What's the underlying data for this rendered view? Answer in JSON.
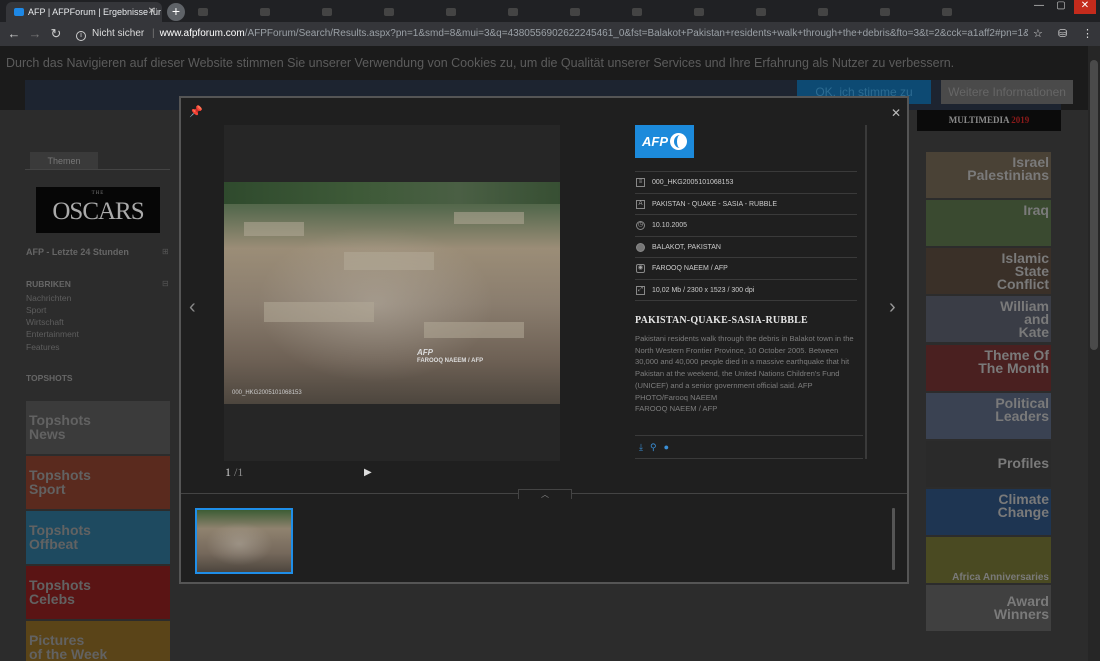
{
  "browser": {
    "active_tab_title": "AFP | AFPForum | Ergebnisse für ...",
    "url_security": "Nicht sicher",
    "url_domain": "www.afpforum.com",
    "url_path": "/AFPForum/Search/Results.aspx?pn=1&smd=8&mui=3&q=4380556902622245461_0&fst=Balakot+Pakistan+residents+walk+through+the+debris&fto=3&t=2&cck=a1aff2#pn=1&smd=8&mui..."
  },
  "cookie_banner": {
    "text": "Durch das Navigieren auf dieser Website stimmen Sie unserer Verwendung von Cookies zu, um die Qualität unserer Services und Ihre Erfahrung als Nutzer zu verbessern.",
    "accept_label": "OK, ich stimme zu",
    "more_label": "Weitere Informationen"
  },
  "page": {
    "multimedia_label": "MULTIMEDIA",
    "multimedia_suffix": "2019",
    "themen_tab": "Themen",
    "oscars_small": "THE",
    "oscars_label": "OSCARS",
    "last24_label": "AFP - Letzte 24 Stunden",
    "rubriken_heading": "RUBRIKEN",
    "rubriken": [
      "Nachrichten",
      "Sport",
      "Wirtschaft",
      "Entertainment",
      "Features"
    ],
    "topshots_heading": "TOPSHOTS",
    "topshots": [
      {
        "line1": "Topshots",
        "line2": "News",
        "color": "#3b3b3b"
      },
      {
        "line1": "Topshots",
        "line2": "Sport",
        "color": "#5a2a1e"
      },
      {
        "line1": "Topshots",
        "line2": "Offbeat",
        "color": "#1e4a60"
      },
      {
        "line1": "Topshots",
        "line2": "Celebs",
        "color": "#5a1414"
      },
      {
        "line1": "Pictures",
        "line2": "of the Week",
        "color": "#5a4418"
      }
    ],
    "right_cards": [
      {
        "line1": "Israel",
        "line2": "Palestinians",
        "line3": "",
        "color": "#4a4236"
      },
      {
        "line1": "Iraq",
        "line2": "",
        "line3": "",
        "color": "#3a4a30"
      },
      {
        "line1": "Islamic",
        "line2": "State",
        "line3": "Conflict",
        "color": "#3a3028"
      },
      {
        "line1": "William",
        "line2": "and",
        "line3": "Kate",
        "color": "#3a3d46"
      },
      {
        "line1": "Theme Of",
        "line2": "The Month",
        "line3": "",
        "color": "#4a2020"
      },
      {
        "line1": "Political",
        "line2": "Leaders",
        "line3": "",
        "color": "#3a4252"
      },
      {
        "line1": "Profiles",
        "line2": "",
        "line3": "",
        "color": "#2a2a2a"
      },
      {
        "line1": "Climate",
        "line2": "Change",
        "line3": "",
        "color": "#1e3552"
      },
      {
        "line1": "Africa Anniversaries",
        "line2": "",
        "line3": "",
        "color": "#4a4a22"
      },
      {
        "line1": "Award",
        "line2": "Winners",
        "line3": "",
        "color": "#404040"
      }
    ]
  },
  "modal": {
    "photo_credit_mark": "AFP",
    "photo_credit_name": "FAROOQ NAEEM / AFP",
    "photo_id_overlay": "000_HKG2005101068153",
    "counter_current": "1",
    "counter_total": "/1",
    "meta": {
      "id": "000_HKG2005101068153",
      "keywords": "PAKISTAN - QUAKE - SASIA - RUBBLE",
      "date": "10.10.2005",
      "location": "BALAKOT, PAKISTAN",
      "photographer": "FAROOQ NAEEM / AFP",
      "filesize": "10,02 Mb / 2300 x 1523 / 300 dpi"
    },
    "caption_title": "PAKISTAN-QUAKE-SASIA-RUBBLE",
    "caption_body": "Pakistani residents walk through the debris in Balakot town in the North Western Frontier Province, 10 October 2005. Between 30,000 and 40,000 people died in a massive earthquake that hit Pakistan at the weekend, the United Nations Children's Fund (UNICEF) and a senior government official said. AFP PHOTO/Farooq NAEEM\nFAROOQ NAEEM / AFP"
  }
}
